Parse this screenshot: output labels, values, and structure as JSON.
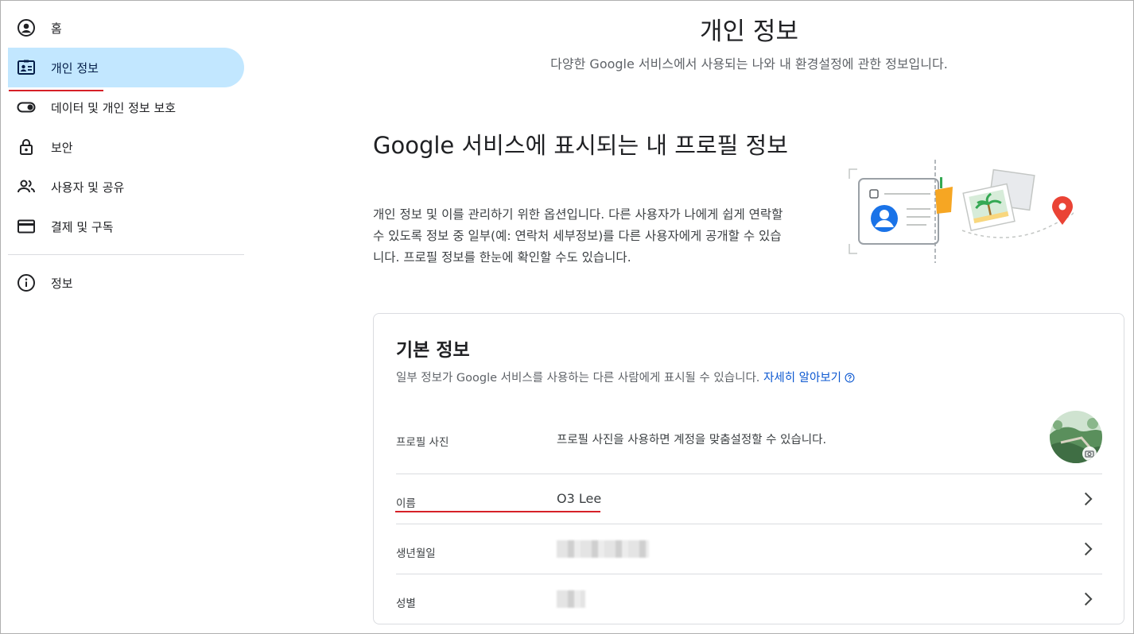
{
  "sidebar": {
    "items": [
      {
        "label": "홈",
        "icon": "account-circle-icon"
      },
      {
        "label": "개인 정보",
        "icon": "id-card-icon",
        "active": true
      },
      {
        "label": "데이터 및 개인 정보 보호",
        "icon": "toggle-icon"
      },
      {
        "label": "보안",
        "icon": "lock-icon"
      },
      {
        "label": "사용자 및 공유",
        "icon": "people-icon"
      },
      {
        "label": "결제 및 구독",
        "icon": "credit-card-icon"
      }
    ],
    "footer_item": {
      "label": "정보",
      "icon": "info-icon"
    }
  },
  "header": {
    "title": "개인 정보",
    "subtitle": "다양한 Google 서비스에서 사용되는 나와 내 환경설정에 관한 정보입니다."
  },
  "intro": {
    "title": "Google 서비스에 표시되는 내 프로필 정보",
    "description": "개인 정보 및 이를 관리하기 위한 옵션입니다. 다른 사용자가 나에게 쉽게 연락할 수 있도록 정보 중 일부(예: 연락처 세부정보)를 다른 사용자에게 공개할 수 있습니다. 프로필 정보를 한눈에 확인할 수도 있습니다."
  },
  "basic_info": {
    "title": "기본 정보",
    "description": "일부 정보가 Google 서비스를 사용하는 다른 사람에게 표시될 수 있습니다.",
    "learn_more": "자세히 알아보기",
    "rows": [
      {
        "label": "프로필 사진",
        "value": "프로필 사진을 사용하면 계정을 맞춤설정할 수 있습니다."
      },
      {
        "label": "이름",
        "value": "O3 Lee"
      },
      {
        "label": "생년월일",
        "value": ""
      },
      {
        "label": "성별",
        "value": ""
      }
    ]
  },
  "colors": {
    "accent": "#c2e7ff",
    "link": "#0b57d0",
    "annotation_red": "#d62028"
  }
}
